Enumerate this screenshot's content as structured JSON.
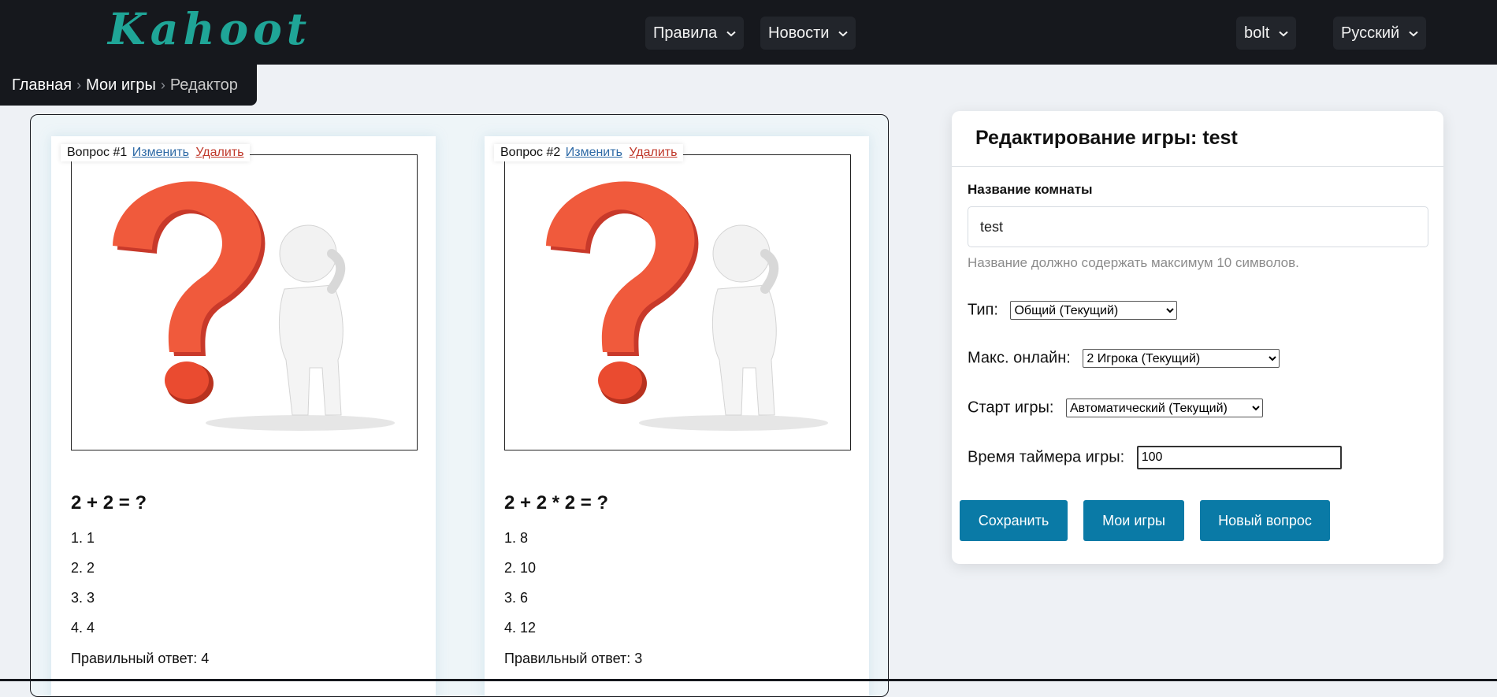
{
  "header": {
    "logo": "Kahoot",
    "nav": [
      {
        "label": "Правила"
      },
      {
        "label": "Новости"
      }
    ],
    "user": "bolt",
    "language": "Русский"
  },
  "breadcrumb": {
    "items": [
      "Главная",
      "Мои игры",
      "Редактор"
    ]
  },
  "questions": [
    {
      "number_label": "Вопрос #1",
      "edit_label": "Изменить",
      "delete_label": "Удалить",
      "text": "2 + 2 = ?",
      "answers": [
        "1. 1",
        "2. 2",
        "3. 3",
        "4. 4"
      ],
      "correct": "Правильный ответ: 4"
    },
    {
      "number_label": "Вопрос #2",
      "edit_label": "Изменить",
      "delete_label": "Удалить",
      "text": "2 + 2 * 2 = ?",
      "answers": [
        "1. 8",
        "2. 10",
        "3. 6",
        "4. 12"
      ],
      "correct": "Правильный ответ: 3"
    }
  ],
  "editor": {
    "title": "Редактирование игры: test",
    "room_label": "Название комнаты",
    "room_value": "test",
    "room_hint": "Название должно содержать максимум 10 символов.",
    "type_label": "Тип:",
    "type_value": "Общий (Текущий)",
    "max_label": "Макс. онлайн:",
    "max_value": "2 Игрока (Текущий)",
    "start_label": "Старт игры:",
    "start_value": "Автоматический (Текущий)",
    "timer_label": "Время таймера игры:",
    "timer_value": "100",
    "buttons": {
      "save": "Сохранить",
      "my_games": "Мои игры",
      "new_question": "Новый вопрос"
    }
  },
  "colors": {
    "header_bg": "#16181d",
    "logo": "#1fa597",
    "button": "#0a7aa6",
    "edit_link": "#2e6aa6",
    "delete_link": "#c0392b"
  }
}
